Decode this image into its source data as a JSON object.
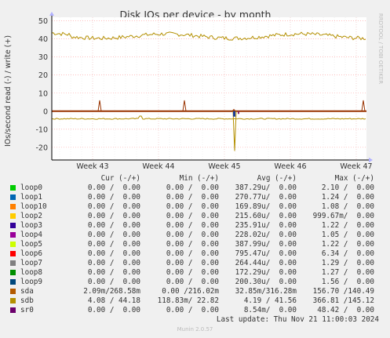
{
  "chart_data": {
    "type": "line",
    "title": "Disk IOs per device - by month",
    "ylabel": "IOs/second read (-) / write (+)",
    "side_label": "RRDTOOL / TOBI OETIKER",
    "ylim": [
      -27,
      52
    ],
    "yticks": [
      50,
      40,
      30,
      20,
      10,
      0,
      -10,
      -20
    ],
    "xticks": [
      "Week 43",
      "Week 44",
      "Week 45",
      "Week 46",
      "Week 47"
    ],
    "grid": true,
    "series": [
      {
        "name": "sdb",
        "color": "#b38f00",
        "write_level": 41.56,
        "read_level": -4.19
      },
      {
        "name": "sda",
        "color": "#993300",
        "write_spikes": [
          6,
          6,
          1,
          6
        ],
        "read_spike": -22
      }
    ],
    "colors": {
      "background": "#f0f0f0",
      "plot": "#ffffff",
      "axis": "#000000",
      "grid": "#ff9999",
      "title": "#333333"
    }
  },
  "legend": {
    "headers": {
      "cur": "Cur (-/+)",
      "min": "Min (-/+)",
      "avg": "Avg (-/+)",
      "max": "Max (-/+)"
    },
    "rows": [
      {
        "name": "loop0",
        "color": "#00cc00",
        "cur": "0.00 /  0.00",
        "min": "0.00 /  0.00",
        "avg": "387.29u/  0.00",
        "max": "2.10 /  0.00"
      },
      {
        "name": "loop1",
        "color": "#0066b3",
        "cur": "0.00 /  0.00",
        "min": "0.00 /  0.00",
        "avg": "270.77u/  0.00",
        "max": "1.24 /  0.00"
      },
      {
        "name": "loop10",
        "color": "#ff8000",
        "cur": "0.00 /  0.00",
        "min": "0.00 /  0.00",
        "avg": "169.89u/  0.00",
        "max": "1.08 /  0.00"
      },
      {
        "name": "loop2",
        "color": "#ffcc00",
        "cur": "0.00 /  0.00",
        "min": "0.00 /  0.00",
        "avg": "215.60u/  0.00",
        "max": "999.67m/  0.00"
      },
      {
        "name": "loop3",
        "color": "#330099",
        "cur": "0.00 /  0.00",
        "min": "0.00 /  0.00",
        "avg": "235.91u/  0.00",
        "max": "1.22 /  0.00"
      },
      {
        "name": "loop4",
        "color": "#990099",
        "cur": "0.00 /  0.00",
        "min": "0.00 /  0.00",
        "avg": "228.02u/  0.00",
        "max": "1.05 /  0.00"
      },
      {
        "name": "loop5",
        "color": "#ccff00",
        "cur": "0.00 /  0.00",
        "min": "0.00 /  0.00",
        "avg": "387.99u/  0.00",
        "max": "1.22 /  0.00"
      },
      {
        "name": "loop6",
        "color": "#ff0000",
        "cur": "0.00 /  0.00",
        "min": "0.00 /  0.00",
        "avg": "795.47u/  0.00",
        "max": "6.34 /  0.00"
      },
      {
        "name": "loop7",
        "color": "#808080",
        "cur": "0.00 /  0.00",
        "min": "0.00 /  0.00",
        "avg": "264.44u/  0.00",
        "max": "1.29 /  0.00"
      },
      {
        "name": "loop8",
        "color": "#008f00",
        "cur": "0.00 /  0.00",
        "min": "0.00 /  0.00",
        "avg": "172.29u/  0.00",
        "max": "1.27 /  0.00"
      },
      {
        "name": "loop9",
        "color": "#00487d",
        "cur": "0.00 /  0.00",
        "min": "0.00 /  0.00",
        "avg": "200.30u/  0.00",
        "max": "1.56 /  0.00"
      },
      {
        "name": "sda",
        "color": "#b35a00",
        "cur": "2.09m/268.58m",
        "min": "0.00 /216.02m",
        "avg": "32.85m/316.28m",
        "max": "156.70 /140.49"
      },
      {
        "name": "sdb",
        "color": "#b38f00",
        "cur": "4.08 / 44.18",
        "min": "118.83m/ 22.82",
        "avg": "4.19 / 41.56",
        "max": "366.81 /145.12"
      },
      {
        "name": "sr0",
        "color": "#6b006b",
        "cur": "0.00 /  0.00",
        "min": "0.00 /  0.00",
        "avg": "8.54m/  0.00",
        "max": "48.42 /  0.00"
      }
    ]
  },
  "footer": {
    "last_update": "Last update: Thu Nov 21 11:00:03 2024",
    "version": "Munin 2.0.57"
  }
}
